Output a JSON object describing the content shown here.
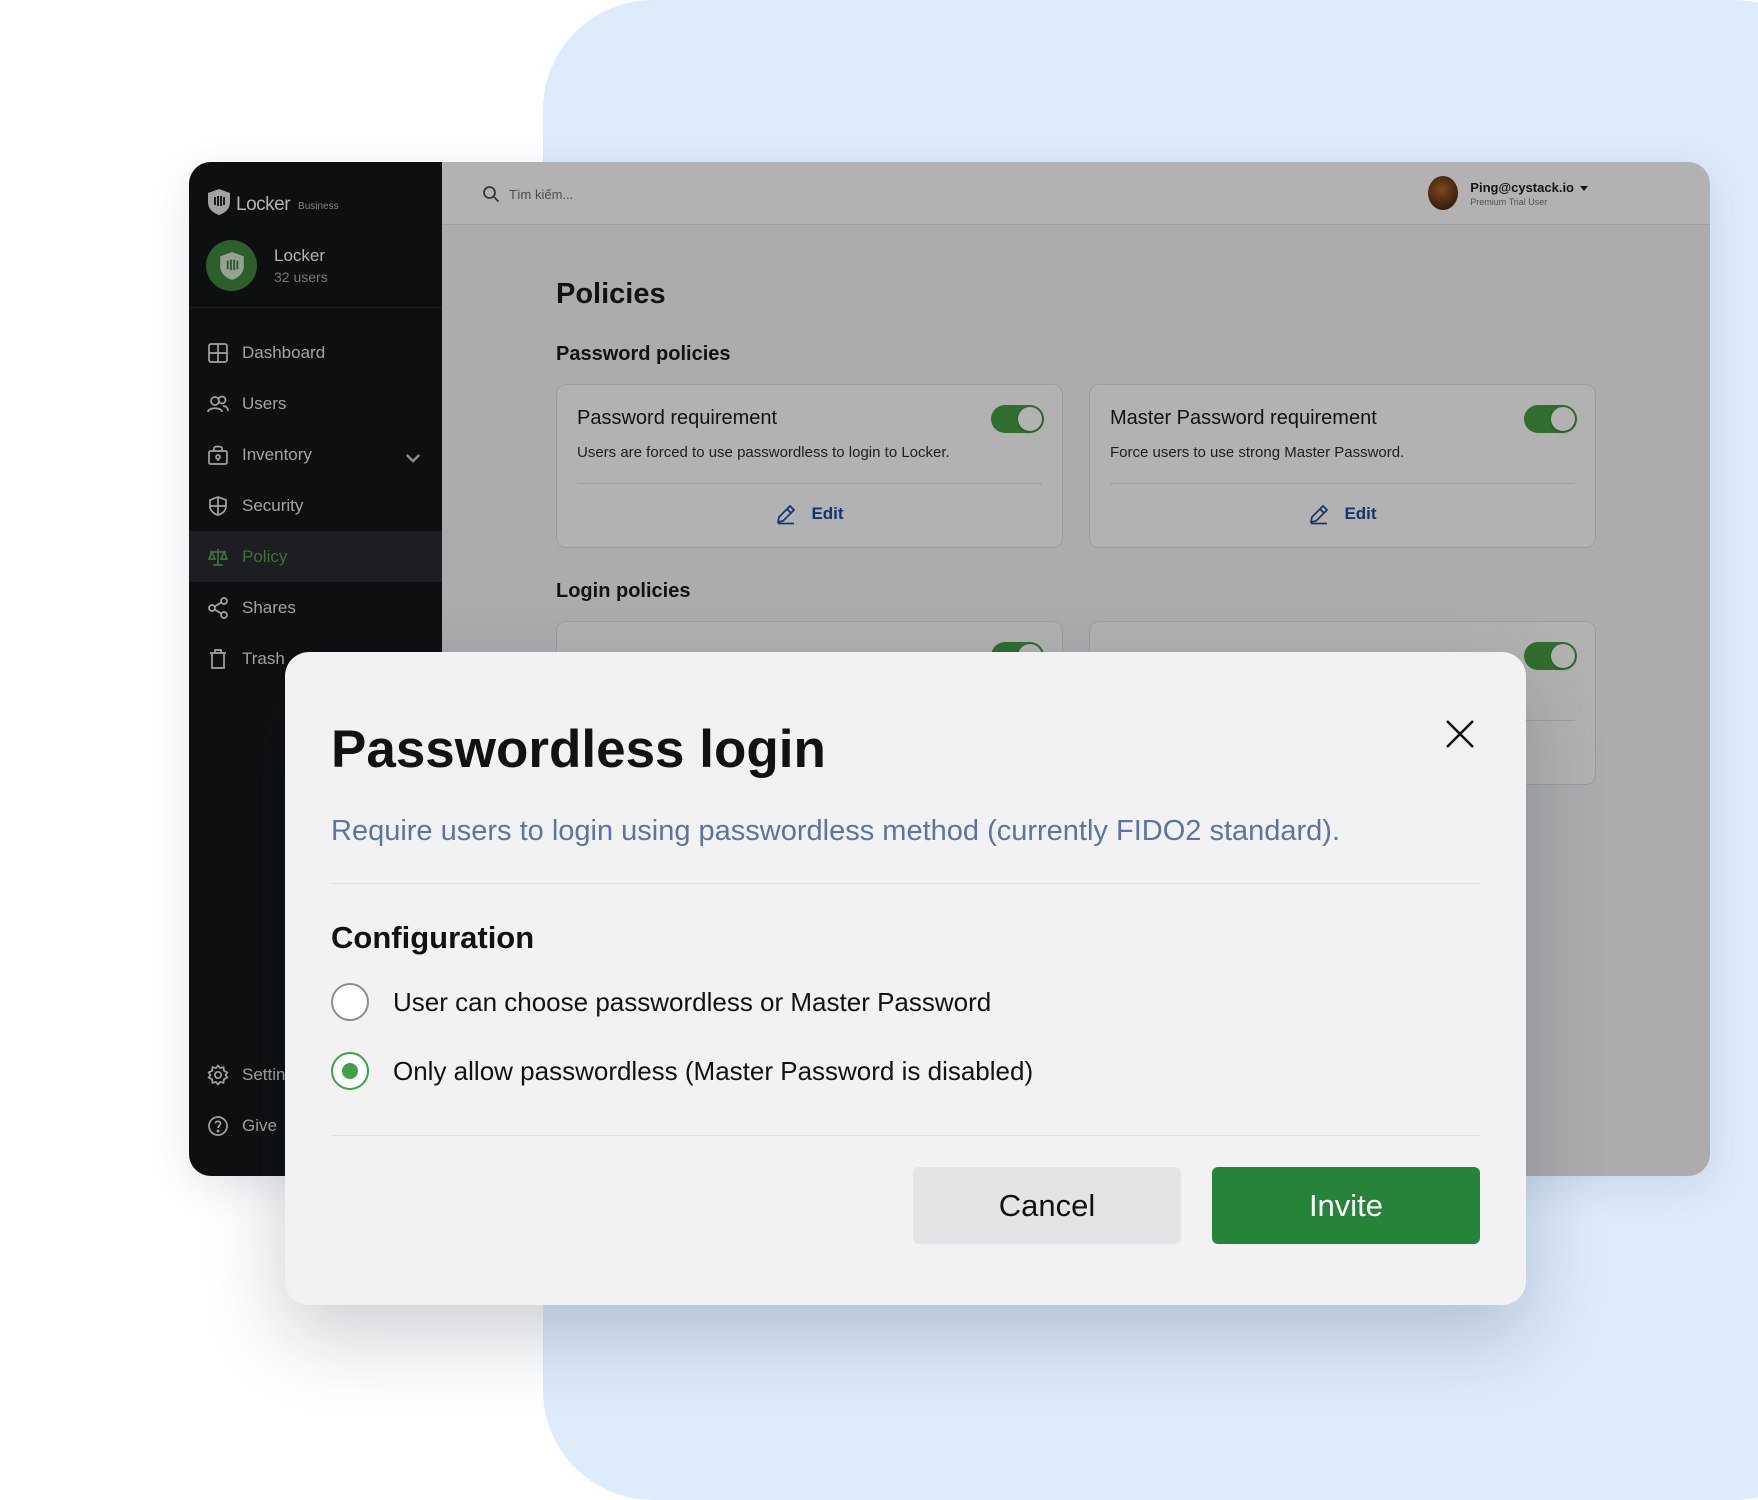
{
  "sidebar": {
    "brand": {
      "name": "Locker",
      "tag": "Business"
    },
    "org": {
      "name": "Locker",
      "users": "32 users"
    },
    "items": [
      {
        "label": "Dashboard",
        "icon": "dashboard-icon"
      },
      {
        "label": "Users",
        "icon": "users-icon"
      },
      {
        "label": "Inventory",
        "icon": "inventory-icon"
      },
      {
        "label": "Security",
        "icon": "shield-icon"
      },
      {
        "label": "Policy",
        "icon": "scale-icon",
        "active": true
      },
      {
        "label": "Shares",
        "icon": "share-icon"
      },
      {
        "label": "Trash",
        "icon": "trash-icon"
      }
    ],
    "bottom_items": [
      {
        "label": "Settin",
        "icon": "gear-icon"
      },
      {
        "label": "Give",
        "icon": "help-icon"
      }
    ]
  },
  "topbar": {
    "search_placeholder": "Tìm kiếm...",
    "user": {
      "email": "Ping@cystack.io",
      "plan": "Premium Trial User"
    }
  },
  "page": {
    "title": "Policies",
    "password_section": "Password policies",
    "login_section": "Login policies",
    "cards": [
      {
        "title": "Password requirement",
        "desc": "Users are forced to use passwordless to login to Locker.",
        "edit": "Edit",
        "enabled": true
      },
      {
        "title": "Master Password requirement",
        "desc": "Force users to use strong Master Password.",
        "edit": "Edit",
        "enabled": true
      }
    ]
  },
  "modal": {
    "title": "Passwordless login",
    "description": "Require users to login using passwordless method (currently FIDO2 standard).",
    "config_title": "Configuration",
    "options": [
      {
        "label": "User can choose passwordless or Master Password",
        "selected": false
      },
      {
        "label": "Only allow passwordless (Master Password is disabled)",
        "selected": true
      }
    ],
    "cancel_label": "Cancel",
    "invite_label": "Invite"
  },
  "colors": {
    "accent_green": "#25843a",
    "toggle_green": "#46a043",
    "link_blue": "#1c4ea0",
    "background_blob": "#dcecfb"
  }
}
